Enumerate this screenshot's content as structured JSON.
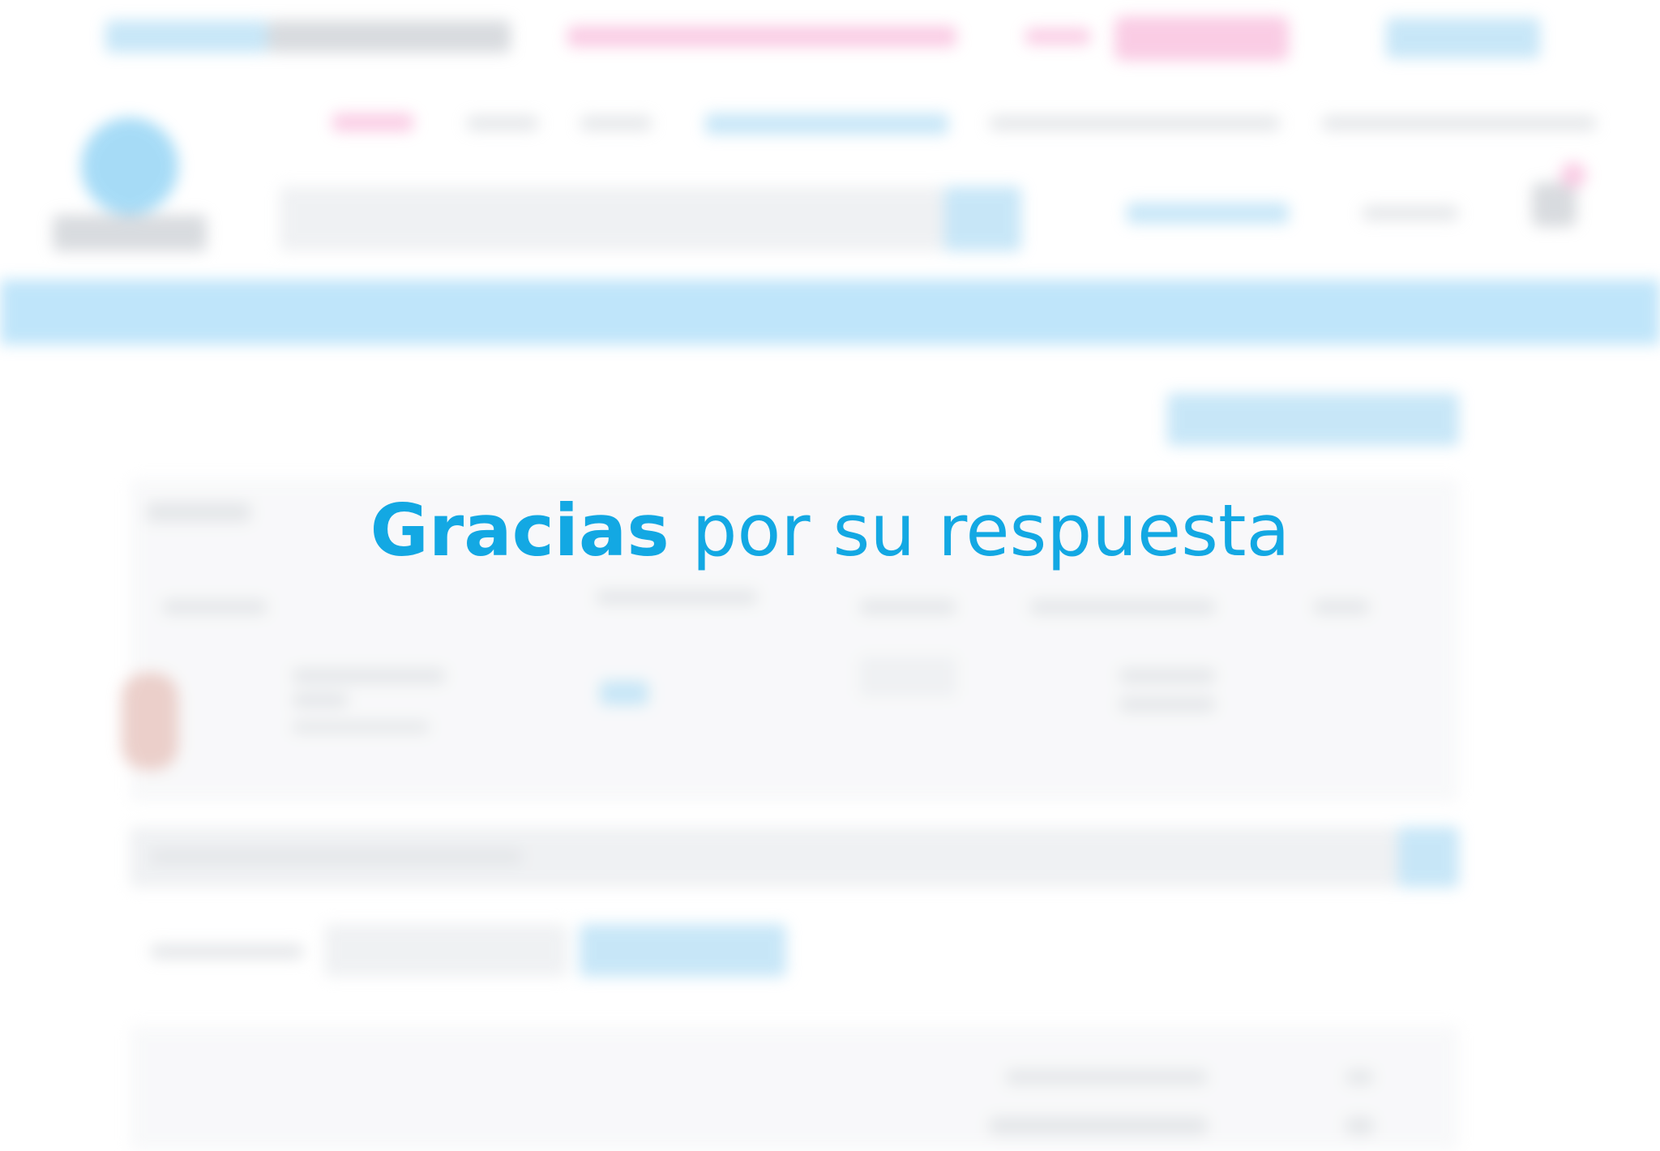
{
  "overlay": {
    "message_strong": "Gracias",
    "message_rest": " por su respuesta"
  },
  "colors": {
    "accent": "#13a8e3",
    "band": "#8cd0f6",
    "promo_pink": "#f6a3cf"
  }
}
